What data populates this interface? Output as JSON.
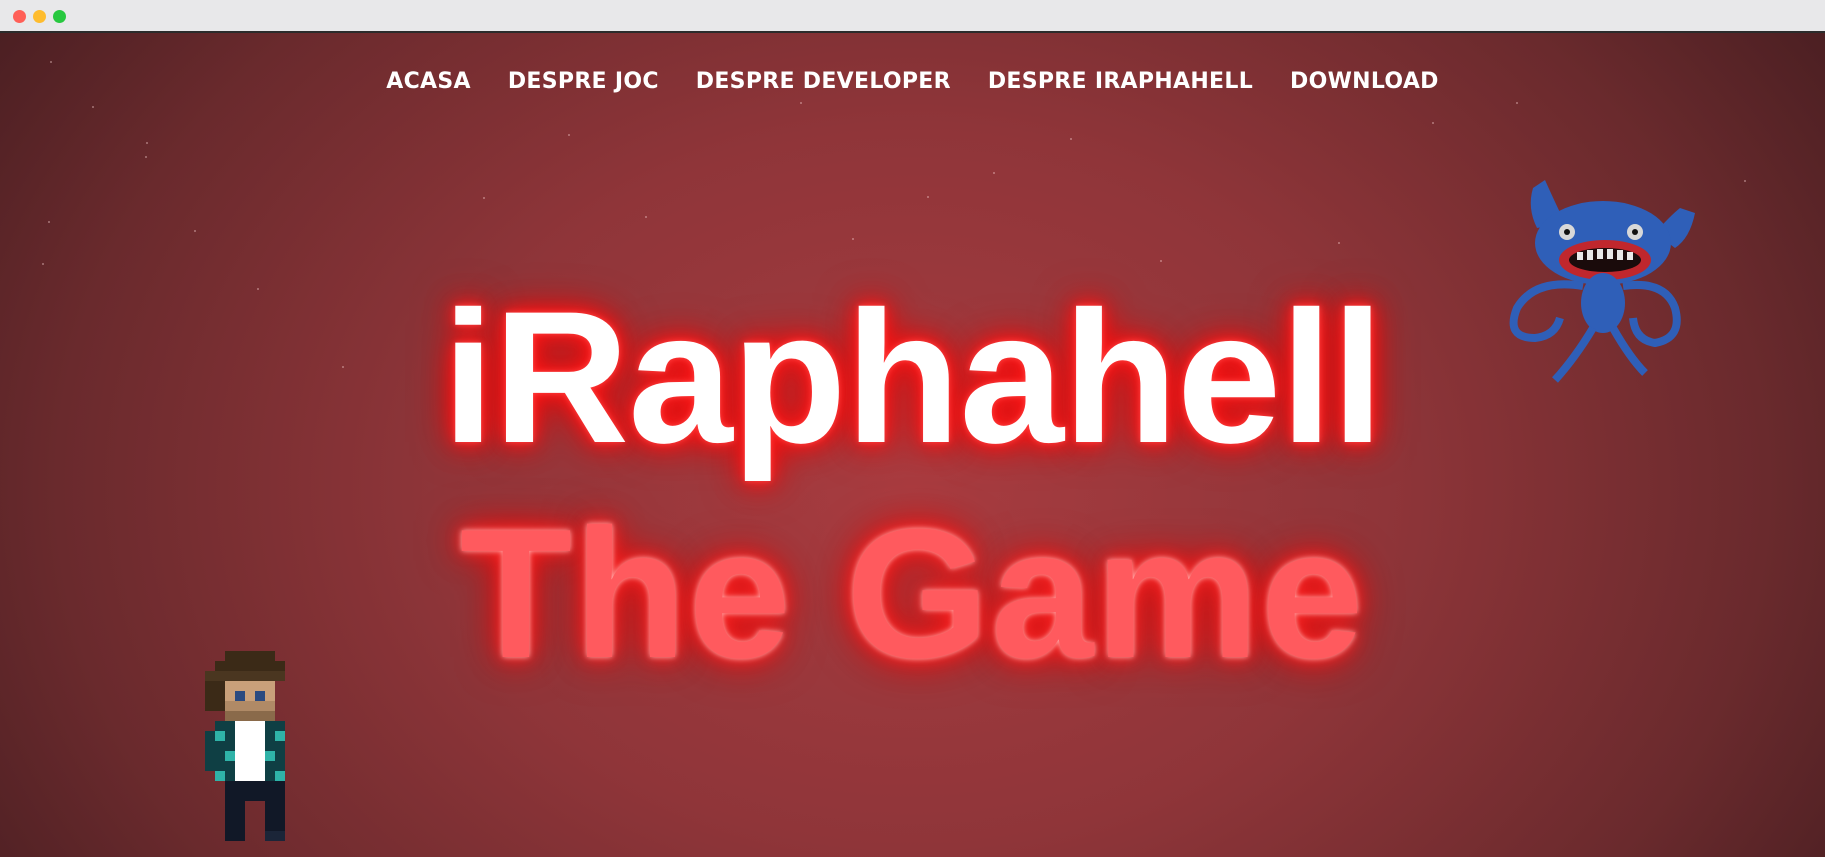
{
  "nav": {
    "items": [
      {
        "label": "ACASA"
      },
      {
        "label": "DESPRE JOC"
      },
      {
        "label": "DESPRE DEVELOPER"
      },
      {
        "label": "DESPRE IRAPHAHELL"
      },
      {
        "label": "DOWNLOAD"
      }
    ]
  },
  "hero": {
    "title": "iRaphahell",
    "subtitle": "The Game"
  },
  "colors": {
    "title_glow": "#ff1a1a",
    "subtitle_fill": "#ff5a5e",
    "background": "#8f3539",
    "monster_blue": "#2f5fb8"
  },
  "icons": {
    "player": "pixel-character-icon",
    "monster": "huggy-wuggy-monster-icon"
  }
}
